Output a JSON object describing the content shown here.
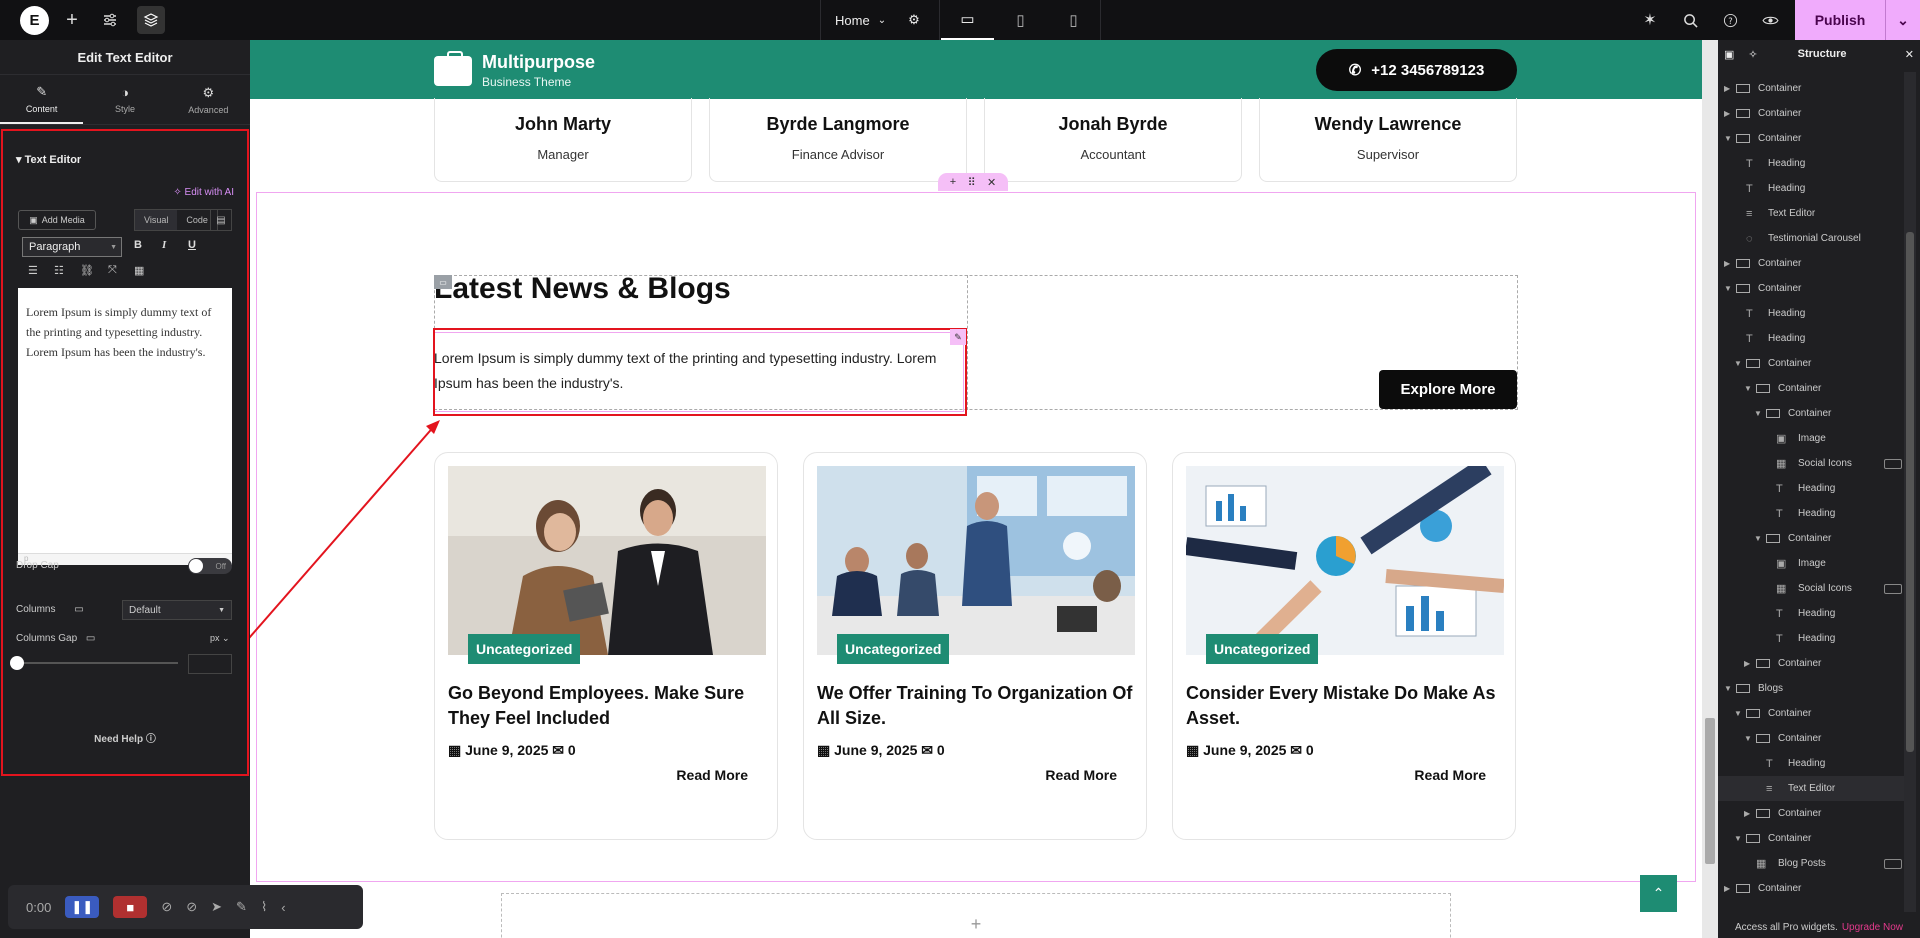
{
  "topbar": {
    "logo": "E",
    "page_selector": "Home",
    "publish_label": "Publish"
  },
  "left_panel": {
    "title": "Edit Text Editor",
    "tabs": [
      {
        "label": "Content",
        "icon": "pencil-icon",
        "active": true
      },
      {
        "label": "Style",
        "icon": "contrast-icon",
        "active": false
      },
      {
        "label": "Advanced",
        "icon": "gear-icon",
        "active": false
      }
    ],
    "section_title": "Text Editor",
    "edit_ai": "Edit with AI",
    "add_media": "Add Media",
    "visual_tab": "Visual",
    "code_tab": "Code",
    "paragraph_format": "Paragraph",
    "editor_content": "Lorem Ipsum is simply dummy text of the printing and typesetting industry. Lorem Ipsum has been the industry's.",
    "editor_path": "p",
    "drop_cap_label": "Drop Cap",
    "drop_cap_value": "Off",
    "columns_label": "Columns",
    "columns_value": "Default",
    "columns_gap_label": "Columns Gap",
    "columns_gap_unit": "px",
    "need_help": "Need Help"
  },
  "site": {
    "brand_name": "Multipurpose",
    "brand_sub": "Business Theme",
    "phone": "+12 3456789123",
    "team": [
      {
        "name": "John Marty",
        "role": "Manager"
      },
      {
        "name": "Byrde Langmore",
        "role": "Finance Advisor"
      },
      {
        "name": "Jonah Byrde",
        "role": "Accountant"
      },
      {
        "name": "Wendy Lawrence",
        "role": "Supervisor"
      }
    ],
    "section_heading": "Latest News & Blogs",
    "section_text": "Lorem Ipsum is simply dummy text of the printing and typesetting industry. Lorem Ipsum has been the industry's.",
    "explore_label": "Explore More",
    "posts": [
      {
        "category": "Uncategorized",
        "title": "Go Beyond Employees. Make Sure They Feel Included",
        "date": "June 9, 2025",
        "comments": "0",
        "read_more": "Read More"
      },
      {
        "category": "Uncategorized",
        "title": "We Offer Training To Organization Of All Size.",
        "date": "June 9, 2025",
        "comments": "0",
        "read_more": "Read More"
      },
      {
        "category": "Uncategorized",
        "title": "Consider Every Mistake Do Make As Asset.",
        "date": "June 9, 2025",
        "comments": "0",
        "read_more": "Read More"
      }
    ]
  },
  "structure": {
    "title": "Structure",
    "nodes": [
      {
        "label": "Container",
        "depth": 0,
        "arrow": "right",
        "icon": "box"
      },
      {
        "label": "Container",
        "depth": 0,
        "arrow": "right",
        "icon": "box"
      },
      {
        "label": "Container",
        "depth": 0,
        "arrow": "down",
        "icon": "box"
      },
      {
        "label": "Heading",
        "depth": 1,
        "arrow": "",
        "icon": "T"
      },
      {
        "label": "Heading",
        "depth": 1,
        "arrow": "",
        "icon": "T"
      },
      {
        "label": "Text Editor",
        "depth": 1,
        "arrow": "",
        "icon": "≡"
      },
      {
        "label": "Testimonial Carousel",
        "depth": 1,
        "arrow": "",
        "icon": "◌"
      },
      {
        "label": "Container",
        "depth": 0,
        "arrow": "right",
        "icon": "box"
      },
      {
        "label": "Container",
        "depth": 0,
        "arrow": "down",
        "icon": "box"
      },
      {
        "label": "Heading",
        "depth": 1,
        "arrow": "",
        "icon": "T"
      },
      {
        "label": "Heading",
        "depth": 1,
        "arrow": "",
        "icon": "T"
      },
      {
        "label": "Container",
        "depth": 1,
        "arrow": "down",
        "icon": "box"
      },
      {
        "label": "Container",
        "depth": 2,
        "arrow": "down",
        "icon": "box"
      },
      {
        "label": "Container",
        "depth": 3,
        "arrow": "down",
        "icon": "box"
      },
      {
        "label": "Image",
        "depth": 4,
        "arrow": "",
        "icon": "▣"
      },
      {
        "label": "Social Icons",
        "depth": 4,
        "arrow": "",
        "icon": "▦",
        "badge": true
      },
      {
        "label": "Heading",
        "depth": 4,
        "arrow": "",
        "icon": "T"
      },
      {
        "label": "Heading",
        "depth": 4,
        "arrow": "",
        "icon": "T"
      },
      {
        "label": "Container",
        "depth": 3,
        "arrow": "down",
        "icon": "box"
      },
      {
        "label": "Image",
        "depth": 4,
        "arrow": "",
        "icon": "▣"
      },
      {
        "label": "Social Icons",
        "depth": 4,
        "arrow": "",
        "icon": "▦",
        "badge": true
      },
      {
        "label": "Heading",
        "depth": 4,
        "arrow": "",
        "icon": "T"
      },
      {
        "label": "Heading",
        "depth": 4,
        "arrow": "",
        "icon": "T"
      },
      {
        "label": "Container",
        "depth": 2,
        "arrow": "right",
        "icon": "box"
      },
      {
        "label": "Blogs",
        "depth": 0,
        "arrow": "down",
        "icon": "box"
      },
      {
        "label": "Container",
        "depth": 1,
        "arrow": "down",
        "icon": "box"
      },
      {
        "label": "Container",
        "depth": 2,
        "arrow": "down",
        "icon": "box"
      },
      {
        "label": "Heading",
        "depth": 3,
        "arrow": "",
        "icon": "T"
      },
      {
        "label": "Text Editor",
        "depth": 3,
        "arrow": "",
        "icon": "≡",
        "selected": true
      },
      {
        "label": "Container",
        "depth": 2,
        "arrow": "right",
        "icon": "box"
      },
      {
        "label": "Container",
        "depth": 1,
        "arrow": "down",
        "icon": "box"
      },
      {
        "label": "Blog Posts",
        "depth": 2,
        "arrow": "",
        "icon": "▦",
        "badge": true
      },
      {
        "label": "Container",
        "depth": 0,
        "arrow": "right",
        "icon": "box"
      }
    ],
    "footer_text": "Access all Pro widgets.",
    "footer_link": "Upgrade Now"
  },
  "recorder": {
    "time": "0:00"
  },
  "colors": {
    "accent": "#1e8c73",
    "publish": "#f0abfc",
    "selection": "#e3141e"
  }
}
